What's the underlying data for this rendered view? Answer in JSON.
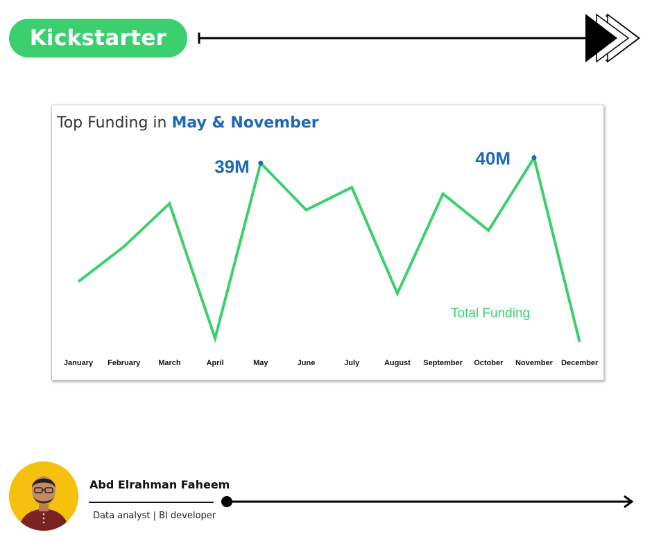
{
  "header": {
    "brand": "Kickstarter"
  },
  "chart_data": {
    "type": "line",
    "title_prefix": "Top Funding in ",
    "title_highlight": "May & November",
    "categories": [
      "January",
      "February",
      "March",
      "April",
      "May",
      "June",
      "July",
      "August",
      "September",
      "October",
      "November",
      "December"
    ],
    "series": [
      {
        "name": "Total Funding",
        "values": [
          17,
          23.5,
          31.5,
          6.5,
          39,
          30.3,
          34.5,
          14.8,
          33.3,
          26.5,
          40,
          5.8
        ],
        "color": "#3ccf6e"
      }
    ],
    "annotations": [
      {
        "category": "May",
        "label": "39M"
      },
      {
        "category": "November",
        "label": "40M"
      }
    ],
    "ylim": [
      0,
      42
    ],
    "grid": false,
    "legend": "bottom-right",
    "highlight_color": "#1f67b8"
  },
  "author": {
    "name": "Abd Elrahman Faheem",
    "role": "Data analyst | BI developer"
  },
  "colors": {
    "accent": "#3ccf6e",
    "highlight": "#1f67b8",
    "background": "#ffffff"
  }
}
